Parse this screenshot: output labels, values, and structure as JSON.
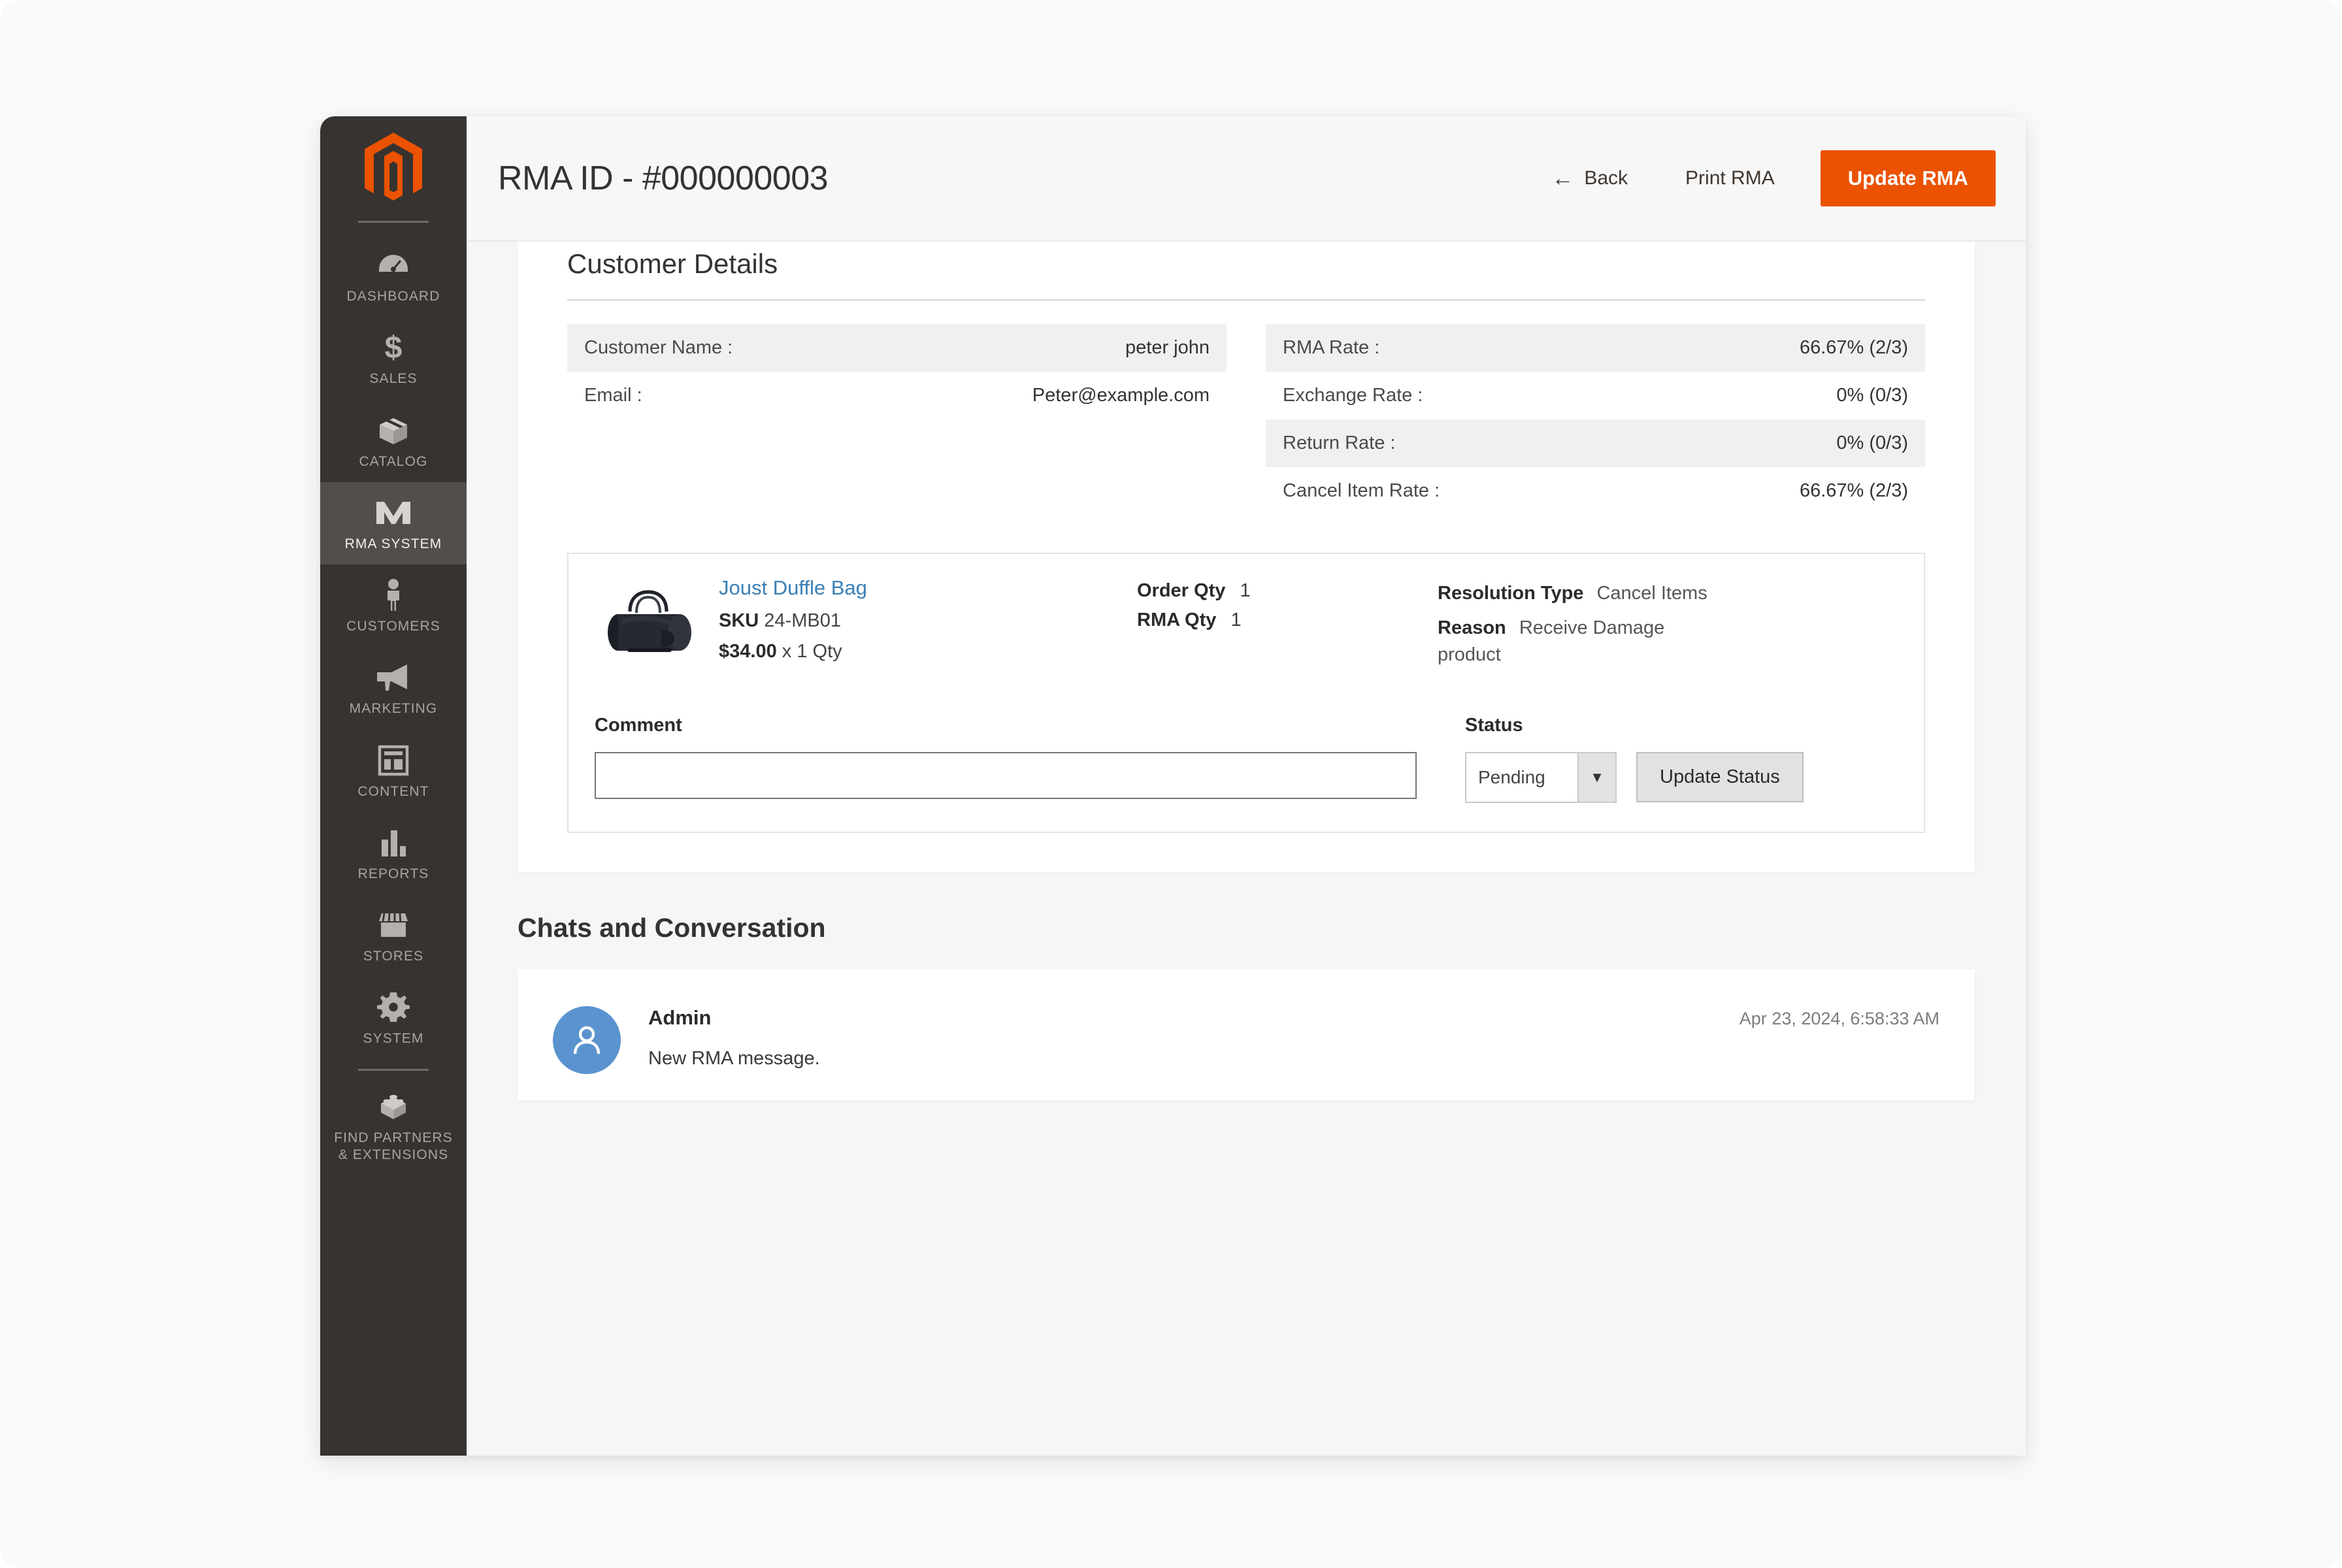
{
  "sidebar": {
    "logo_icon": "magento-logo-icon",
    "items": [
      {
        "label": "DASHBOARD",
        "icon": "dashboard-gauge-icon",
        "active": false
      },
      {
        "label": "SALES",
        "icon": "dollar-sign-icon",
        "active": false
      },
      {
        "label": "CATALOG",
        "icon": "box-icon",
        "active": false
      },
      {
        "label": "RMA SYSTEM",
        "icon": "rma-w-icon",
        "active": true
      },
      {
        "label": "CUSTOMERS",
        "icon": "person-icon",
        "active": false
      },
      {
        "label": "MARKETING",
        "icon": "megaphone-icon",
        "active": false
      },
      {
        "label": "CONTENT",
        "icon": "layout-page-icon",
        "active": false
      },
      {
        "label": "REPORTS",
        "icon": "bar-chart-icon",
        "active": false
      },
      {
        "label": "STORES",
        "icon": "storefront-icon",
        "active": false
      },
      {
        "label": "SYSTEM",
        "icon": "gear-icon",
        "active": false
      },
      {
        "label": "FIND PARTNERS\n& EXTENSIONS",
        "icon": "puzzle-brick-icon",
        "active": false
      }
    ]
  },
  "header": {
    "title": "RMA ID - #000000003",
    "back_label": "Back",
    "back_icon": "arrow-left-icon",
    "print_label": "Print RMA",
    "update_label": "Update RMA",
    "accent_color": "#eb5202"
  },
  "customer_details": {
    "section_title": "Customer Details",
    "left_rows": [
      {
        "label": "Customer Name :",
        "value": "peter john",
        "shaded": true
      },
      {
        "label": "Email :",
        "value": "Peter@example.com",
        "shaded": false
      }
    ],
    "right_rows": [
      {
        "label": "RMA Rate :",
        "value": "66.67% (2/3)",
        "shaded": true
      },
      {
        "label": "Exchange Rate :",
        "value": "0% (0/3)",
        "shaded": false
      },
      {
        "label": "Return Rate :",
        "value": "0% (0/3)",
        "shaded": true
      },
      {
        "label": "Cancel Item Rate :",
        "value": "66.67% (2/3)",
        "shaded": false
      }
    ]
  },
  "item": {
    "thumb_icon": "duffle-bag-thumbnail",
    "product_name": "Joust Duffle Bag",
    "sku_label": "SKU",
    "sku_value": "24-MB01",
    "price": "$34.00",
    "price_qty": "x 1 Qty",
    "order_qty_label": "Order Qty",
    "order_qty_value": "1",
    "rma_qty_label": "RMA Qty",
    "rma_qty_value": "1",
    "resolution_label": "Resolution Type",
    "resolution_value": "Cancel Items",
    "reason_label": "Reason",
    "reason_value": "Receive Damage product"
  },
  "form": {
    "comment_label": "Comment",
    "comment_value": "",
    "comment_placeholder": "",
    "status_label": "Status",
    "status_value": "Pending",
    "status_options": [
      "Pending"
    ],
    "dropdown_icon": "chevron-down-icon",
    "update_status_label": "Update Status"
  },
  "chats": {
    "section_title": "Chats and Conversation",
    "messages": [
      {
        "avatar_icon": "user-avatar-icon",
        "author": "Admin",
        "timestamp": "Apr 23, 2024, 6:58:33 AM",
        "text": "New RMA message."
      }
    ]
  }
}
